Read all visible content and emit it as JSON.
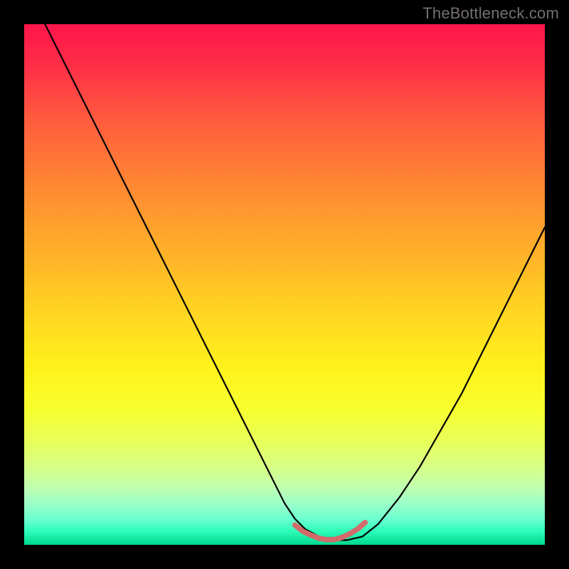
{
  "watermark": "TheBottleneck.com",
  "chart_data": {
    "type": "line",
    "title": "",
    "xlabel": "",
    "ylabel": "",
    "xlim": [
      0,
      100
    ],
    "ylim": [
      0,
      100
    ],
    "grid": false,
    "series": [
      {
        "name": "curve-black",
        "stroke": "#000000",
        "width": 2.2,
        "x": [
          4,
          8,
          12,
          16,
          20,
          24,
          28,
          32,
          36,
          40,
          44,
          48,
          50,
          52,
          54,
          57,
          60,
          62,
          65,
          68,
          72,
          76,
          80,
          84,
          88,
          92,
          96,
          100
        ],
        "y": [
          100,
          92,
          84,
          76,
          68,
          60,
          52,
          44,
          36,
          28,
          20,
          12,
          8,
          5,
          3,
          1.4,
          0.9,
          0.9,
          1.6,
          4,
          9,
          15,
          22,
          29,
          37,
          45,
          53,
          61
        ]
      },
      {
        "name": "curve-pink-bottom",
        "stroke": "#d46a6b",
        "width": 7.5,
        "x": [
          52,
          53.5,
          55,
          56.5,
          58,
          59.5,
          61,
          62.5,
          64,
          65.5
        ],
        "y": [
          3.8,
          2.6,
          1.9,
          1.3,
          1.0,
          1.0,
          1.4,
          2.1,
          3.0,
          4.3
        ]
      }
    ],
    "background_gradient": {
      "stops": [
        {
          "pos": 0.0,
          "color": "#ff154c"
        },
        {
          "pos": 0.5,
          "color": "#ffd122"
        },
        {
          "pos": 0.8,
          "color": "#e8ff58"
        },
        {
          "pos": 1.0,
          "color": "#00d98e"
        }
      ]
    }
  }
}
